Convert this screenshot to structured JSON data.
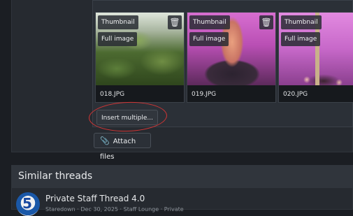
{
  "attachments": [
    {
      "filename": "018.JPG",
      "thumbnail_label": "Thumbnail",
      "full_label": "Full image"
    },
    {
      "filename": "019.JPG",
      "thumbnail_label": "Thumbnail",
      "full_label": "Full image"
    },
    {
      "filename": "020.JPG",
      "thumbnail_label": "Thumbnail",
      "full_label": "Full image"
    }
  ],
  "buttons": {
    "insert_multiple": "Insert multiple...",
    "attach_files": "Attach files"
  },
  "icons": {
    "delete": "trash-icon",
    "attach": "paperclip-icon"
  },
  "similar_threads": {
    "title": "Similar threads",
    "items": [
      {
        "title": "Private Staff Thread 4.0",
        "meta": "Staredown · Dec 30, 2025 · Staff Lounge · Private"
      }
    ]
  },
  "colors": {
    "annotation_circle": "#d03535",
    "background": "#1b1e23"
  }
}
